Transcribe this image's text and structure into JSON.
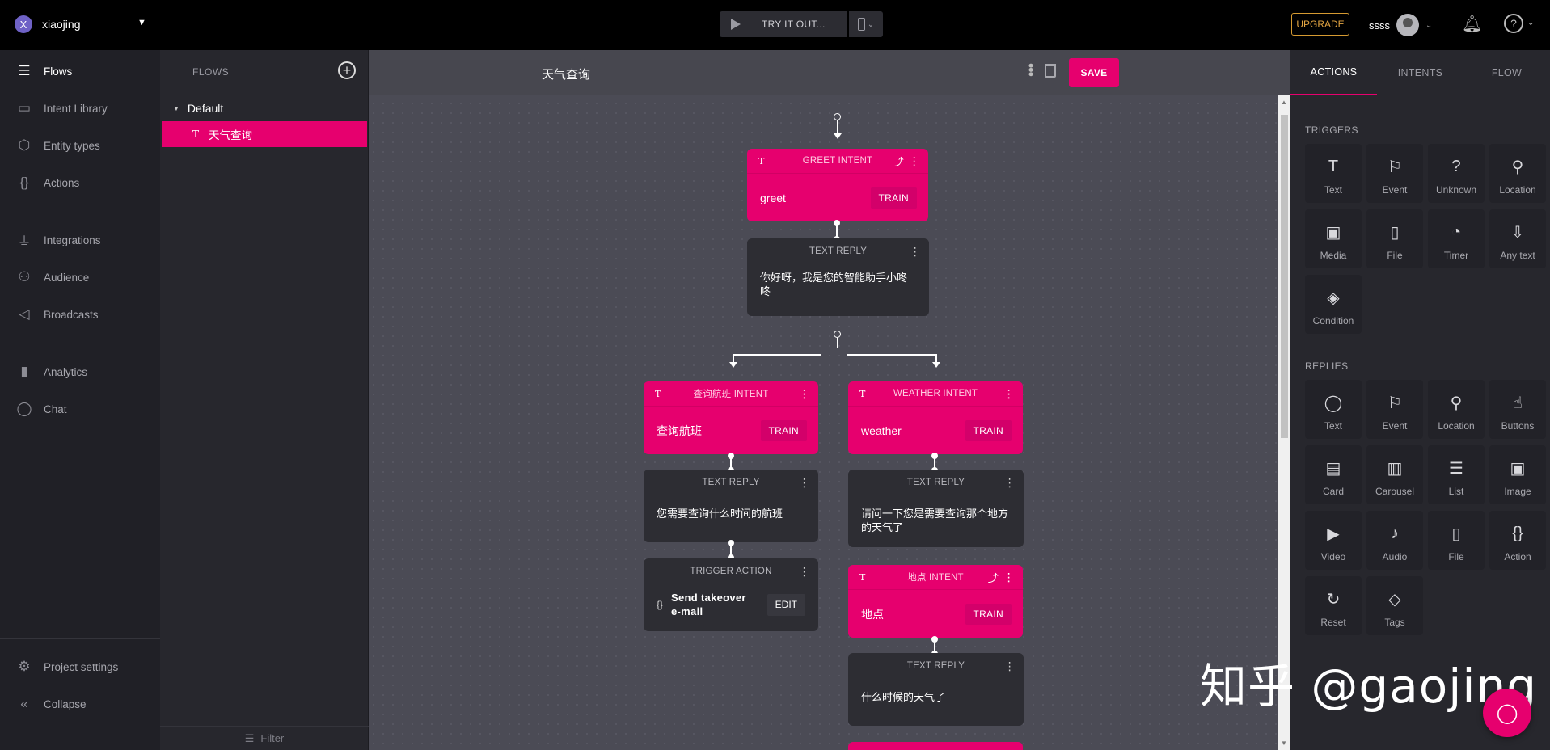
{
  "topbar": {
    "project_initial": "X",
    "project_name": "xiaojing",
    "try_label": "TRY IT OUT...",
    "upgrade_label": "UPGRADE",
    "username": "ssss"
  },
  "nav": {
    "items": [
      {
        "label": "Flows",
        "icon": "flows-icon"
      },
      {
        "label": "Intent Library",
        "icon": "inbox-icon"
      },
      {
        "label": "Entity types",
        "icon": "cube-icon"
      },
      {
        "label": "Actions",
        "icon": "braces-icon"
      },
      {
        "label": "Integrations",
        "icon": "plug-icon"
      },
      {
        "label": "Audience",
        "icon": "people-icon"
      },
      {
        "label": "Broadcasts",
        "icon": "megaphone-icon"
      },
      {
        "label": "Analytics",
        "icon": "bar-chart-icon"
      },
      {
        "label": "Chat",
        "icon": "chat-icon"
      },
      {
        "label": "Project settings",
        "icon": "gear-icon"
      },
      {
        "label": "Collapse",
        "icon": "collapse-icon"
      }
    ]
  },
  "flows": {
    "title": "FLOWS",
    "group": "Default",
    "item_icon": "T",
    "item": "天气查询",
    "filter": "Filter"
  },
  "canvas": {
    "title": "天气查询",
    "save_label": "SAVE",
    "nodes": {
      "greet_intent": {
        "header": "GREET INTENT",
        "value": "greet",
        "train": "TRAIN"
      },
      "greet_reply": {
        "header": "TEXT REPLY",
        "text": "你好呀，我是您的智能助手小咚咚"
      },
      "flight_intent": {
        "header": "查询航班 INTENT",
        "value": "查询航班",
        "train": "TRAIN"
      },
      "flight_reply": {
        "header": "TEXT REPLY",
        "text": "您需要查询什么时间的航班"
      },
      "trigger_action": {
        "header": "TRIGGER ACTION",
        "text": "Send takeover e-mail",
        "edit": "EDIT"
      },
      "weather_intent": {
        "header": "WEATHER INTENT",
        "value": "weather",
        "train": "TRAIN"
      },
      "weather_reply": {
        "header": "TEXT REPLY",
        "text": "请问一下您是需要查询那个地方的天气了"
      },
      "place_intent": {
        "header": "地点 INTENT",
        "value": "地点",
        "train": "TRAIN"
      },
      "place_reply": {
        "header": "TEXT REPLY",
        "text": "什么时候的天气了"
      }
    }
  },
  "right": {
    "tabs": [
      "ACTIONS",
      "INTENTS",
      "FLOW"
    ],
    "triggers_title": "TRIGGERS",
    "triggers": [
      {
        "label": "Text",
        "glyph": "T"
      },
      {
        "label": "Event",
        "glyph": "⚐"
      },
      {
        "label": "Unknown",
        "glyph": "?"
      },
      {
        "label": "Location",
        "glyph": "⚲"
      },
      {
        "label": "Media",
        "glyph": "▣"
      },
      {
        "label": "File",
        "glyph": "▯"
      },
      {
        "label": "Timer",
        "glyph": "◔"
      },
      {
        "label": "Any text",
        "glyph": "⇩"
      },
      {
        "label": "Condition",
        "glyph": "◈"
      }
    ],
    "replies_title": "REPLIES",
    "replies": [
      {
        "label": "Text",
        "glyph": "◯"
      },
      {
        "label": "Event",
        "glyph": "⚐"
      },
      {
        "label": "Location",
        "glyph": "⚲"
      },
      {
        "label": "Buttons",
        "glyph": "☝"
      },
      {
        "label": "Card",
        "glyph": "▤"
      },
      {
        "label": "Carousel",
        "glyph": "▥"
      },
      {
        "label": "List",
        "glyph": "☰"
      },
      {
        "label": "Image",
        "glyph": "▣"
      },
      {
        "label": "Video",
        "glyph": "▶"
      },
      {
        "label": "Audio",
        "glyph": "♪"
      },
      {
        "label": "File",
        "glyph": "▯"
      },
      {
        "label": "Action",
        "glyph": "{}"
      },
      {
        "label": "Reset",
        "glyph": "↻"
      },
      {
        "label": "Tags",
        "glyph": "◇"
      }
    ]
  },
  "watermark": "知乎 @gaojing"
}
